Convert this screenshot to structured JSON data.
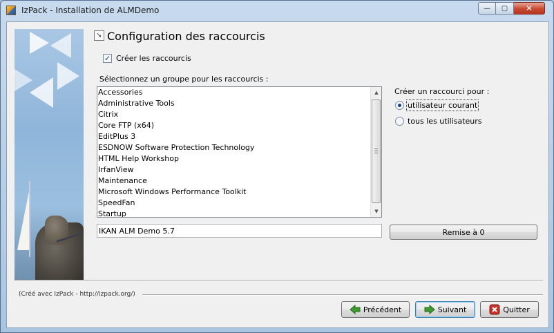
{
  "window": {
    "title": "IzPack - Installation de ALMDemo",
    "controls": {
      "minimize": "—",
      "maximize": "▢",
      "close": "✕"
    }
  },
  "page": {
    "title": "Configuration des raccourcis",
    "create_shortcuts": {
      "label": "Créer les raccourcis",
      "checked": true
    },
    "group_label": "Sélectionnez un groupe pour les raccourcis :",
    "program_groups": [
      "Accessories",
      "Administrative Tools",
      "Citrix",
      "Core FTP (x64)",
      "EditPlus 3",
      "ESDNOW Software Protection Technology",
      "HTML Help Workshop",
      "IrfanView",
      "Maintenance",
      "Microsoft Windows Performance Toolkit",
      "SpeedFan",
      "Startup"
    ],
    "group_name_value": "IKAN ALM Demo 5.7",
    "reset_button": "Remise à 0",
    "shortcut_for": {
      "label": "Créer un raccourci pour :",
      "options": [
        {
          "label": "utilisateur courant",
          "selected": true
        },
        {
          "label": "tous les utilisateurs",
          "selected": false
        }
      ]
    }
  },
  "footer": {
    "credit": "(Créé avec IzPack - http://izpack.org/)",
    "buttons": {
      "previous": "Précédent",
      "next": "Suivant",
      "quit": "Quitter"
    }
  },
  "colors": {
    "accent_check": "#1a3f8a",
    "arrow_green": "#3f9a2e",
    "quit_red": "#c8302a",
    "titlebar": "#c8daee"
  },
  "icons": {
    "app": "izpack-app-icon",
    "header": "panel-arrow-icon",
    "previous": "green-arrow-left-icon",
    "next": "green-arrow-right-icon",
    "quit": "red-x-icon"
  }
}
